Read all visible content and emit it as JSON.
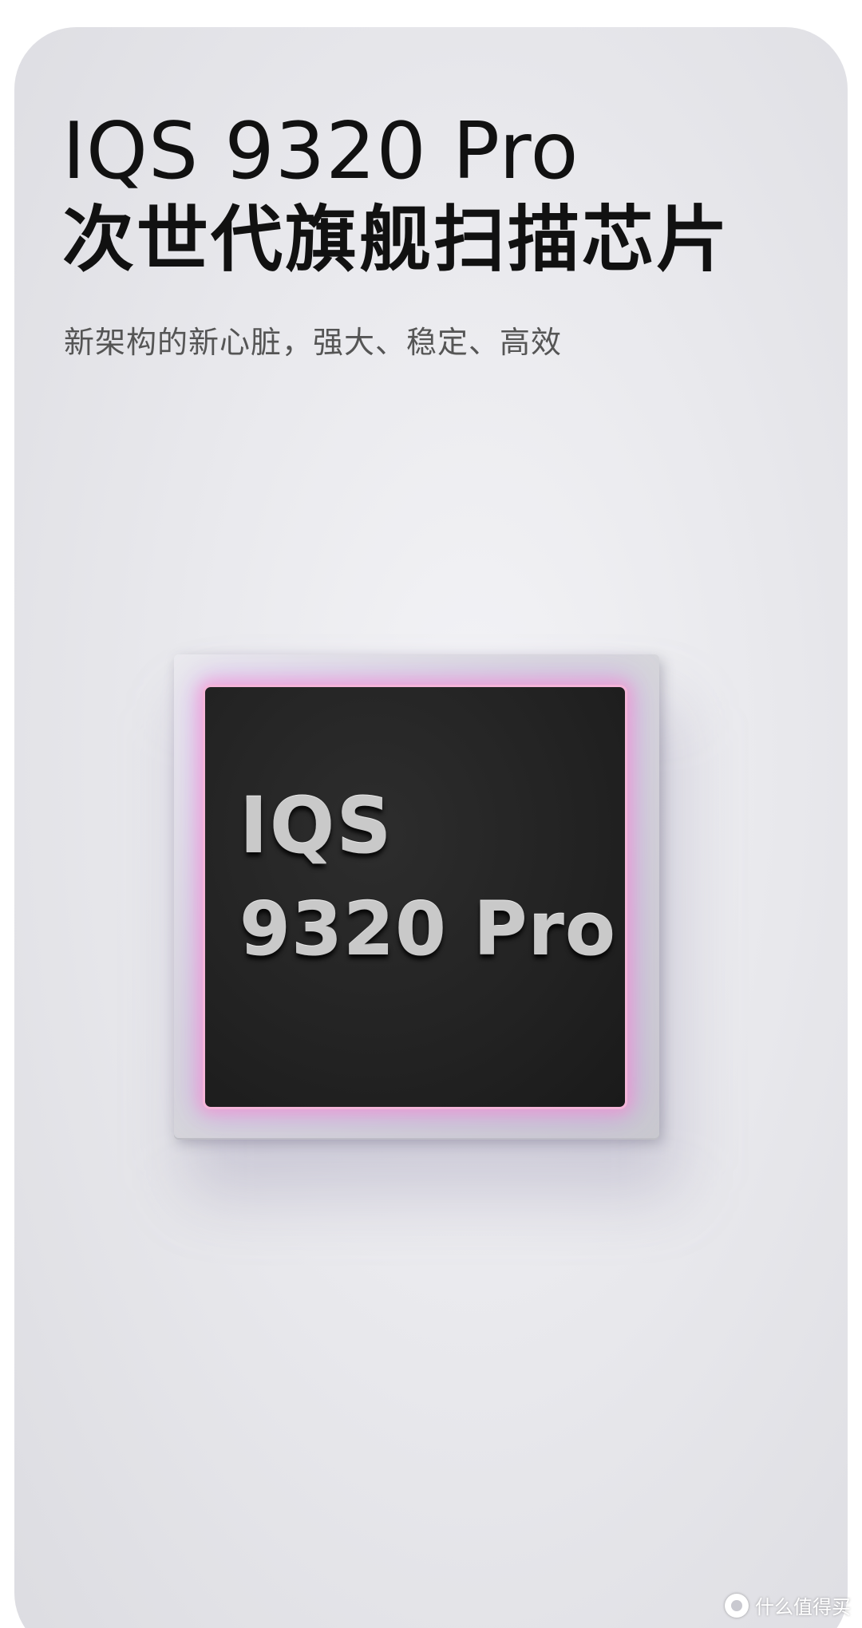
{
  "headline": {
    "line1": "IQS 9320 Pro",
    "line2": "次世代旗舰扫描芯片"
  },
  "subtitle": "新架构的新心脏，强大、稳定、高效",
  "chip": {
    "label_line1": "IQS",
    "label_line2": "9320 Pro"
  },
  "watermark": {
    "text": "什么值得买",
    "icon": "zhidemai-logo-icon"
  },
  "colors": {
    "background": "#e9e9ed",
    "headline": "#111111",
    "subtitle": "#555555",
    "chip_core": "#222222",
    "chip_glow_pink": "#ff8cc8",
    "chip_glow_purple": "#be6eff"
  }
}
